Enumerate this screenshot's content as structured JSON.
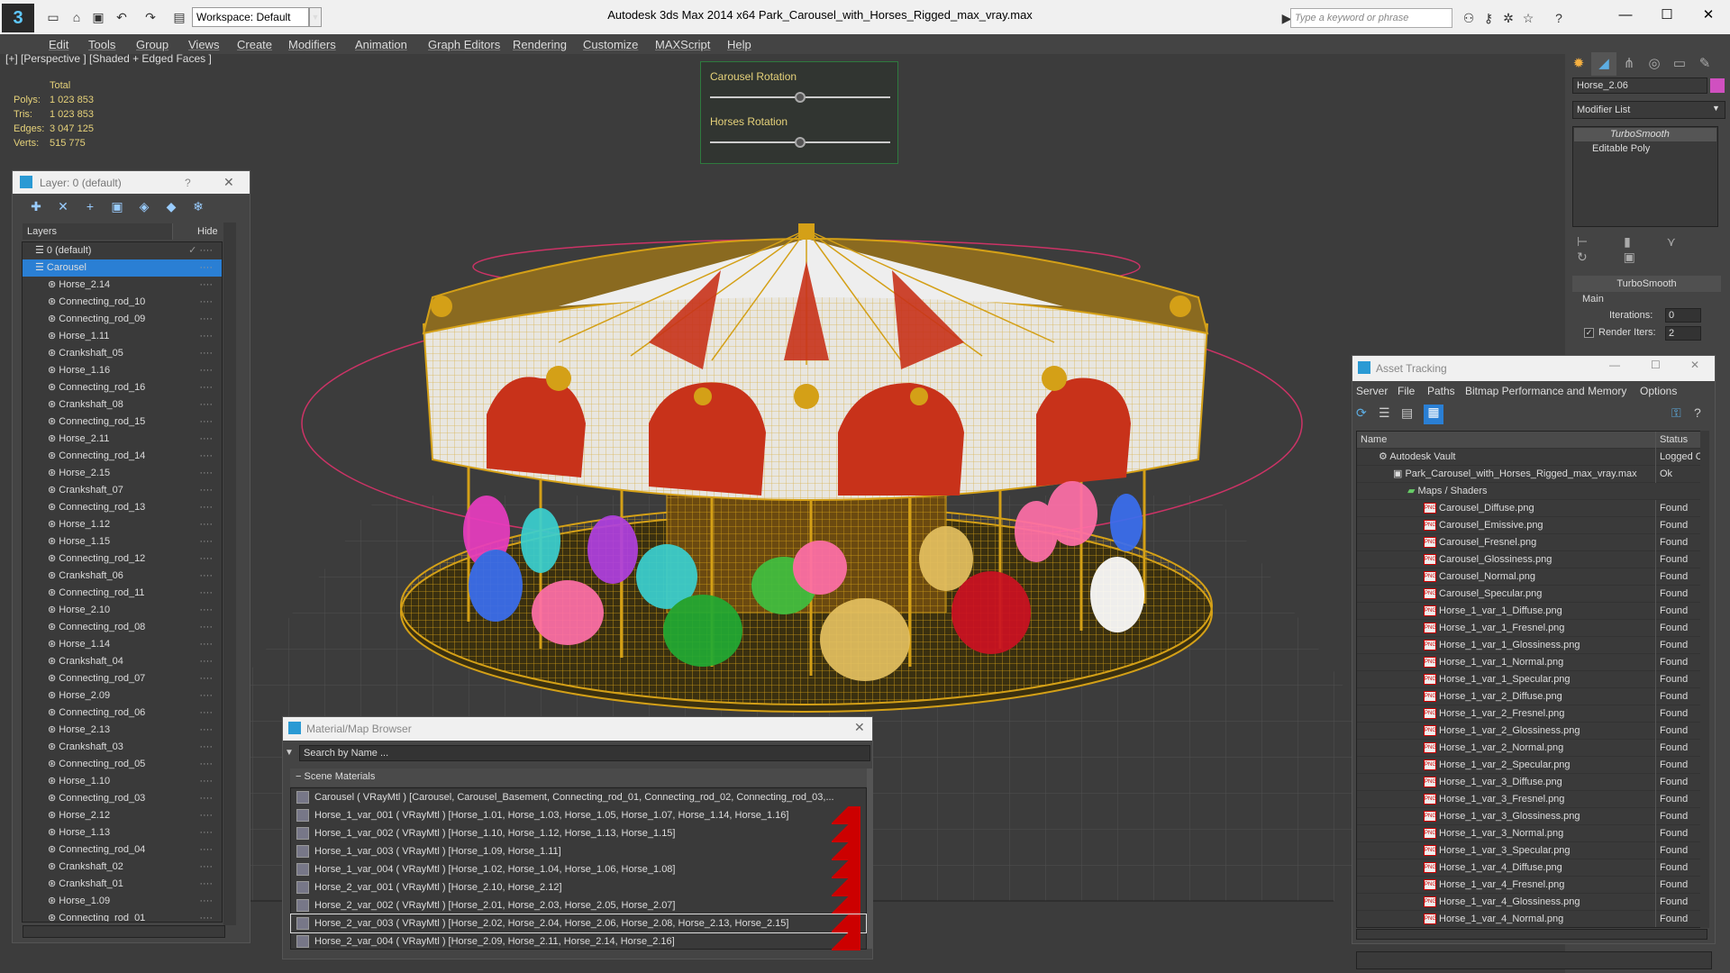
{
  "app": {
    "title": "Autodesk 3ds Max  2014 x64      Park_Carousel_with_Horses_Rigged_max_vray.max",
    "workspace": "Workspace: Default",
    "search_placeholder": "Type a keyword or phrase"
  },
  "menu": [
    "Edit",
    "Tools",
    "Group",
    "Views",
    "Create",
    "Modifiers",
    "Animation",
    "Graph Editors",
    "Rendering",
    "Customize",
    "MAXScript",
    "Help"
  ],
  "viewport": {
    "label": "[+] [Perspective ] [Shaded + Edged Faces ]",
    "stats_header": "Total",
    "stats": [
      {
        "label": "Polys:",
        "value": "1 023 853"
      },
      {
        "label": "Tris:",
        "value": "1 023 853"
      },
      {
        "label": "Edges:",
        "value": "3 047 125"
      },
      {
        "label": "Verts:",
        "value": "515 775"
      }
    ]
  },
  "sliders": [
    {
      "label": "Carousel Rotation",
      "value": 0.5
    },
    {
      "label": "Horses Rotation",
      "value": 0.5
    }
  ],
  "layer_panel": {
    "title": "Layer: 0 (default)",
    "help": "?",
    "col_layers": "Layers",
    "col_hide": "Hide",
    "items": [
      "0 (default)",
      "Carousel",
      "Horse_2.14",
      "Connecting_rod_10",
      "Connecting_rod_09",
      "Horse_1.11",
      "Crankshaft_05",
      "Horse_1.16",
      "Connecting_rod_16",
      "Crankshaft_08",
      "Connecting_rod_15",
      "Horse_2.11",
      "Connecting_rod_14",
      "Horse_2.15",
      "Crankshaft_07",
      "Connecting_rod_13",
      "Horse_1.12",
      "Horse_1.15",
      "Connecting_rod_12",
      "Crankshaft_06",
      "Connecting_rod_11",
      "Horse_2.10",
      "Connecting_rod_08",
      "Horse_1.14",
      "Crankshaft_04",
      "Connecting_rod_07",
      "Horse_2.09",
      "Connecting_rod_06",
      "Horse_2.13",
      "Crankshaft_03",
      "Connecting_rod_05",
      "Horse_1.10",
      "Connecting_rod_03",
      "Horse_2.12",
      "Horse_1.13",
      "Connecting_rod_04",
      "Crankshaft_02",
      "Crankshaft_01",
      "Horse_1.09",
      "Connecting_rod_01"
    ]
  },
  "command_panel": {
    "object_name": "Horse_2.06",
    "modifier_list": "Modifier List",
    "stack": [
      "TurboSmooth",
      "Editable Poly"
    ],
    "rollout_title": "TurboSmooth",
    "group_main": "Main",
    "iterations_label": "Iterations:",
    "iterations_value": "0",
    "render_iters_label": "Render Iters:",
    "render_iters_value": "2"
  },
  "asset_tracking": {
    "title": "Asset Tracking",
    "menu": [
      "Server",
      "File",
      "Paths",
      "Bitmap Performance and Memory",
      "Options"
    ],
    "col_name": "Name",
    "col_status": "Status",
    "vault": {
      "name": "Autodesk Vault",
      "status": "Logged O"
    },
    "file": {
      "name": "Park_Carousel_with_Horses_Rigged_max_vray.max",
      "status": "Ok"
    },
    "maps_group": "Maps / Shaders",
    "maps": [
      "Carousel_Diffuse.png",
      "Carousel_Emissive.png",
      "Carousel_Fresnel.png",
      "Carousel_Glossiness.png",
      "Carousel_Normal.png",
      "Carousel_Specular.png",
      "Horse_1_var_1_Diffuse.png",
      "Horse_1_var_1_Fresnel.png",
      "Horse_1_var_1_Glossiness.png",
      "Horse_1_var_1_Normal.png",
      "Horse_1_var_1_Specular.png",
      "Horse_1_var_2_Diffuse.png",
      "Horse_1_var_2_Fresnel.png",
      "Horse_1_var_2_Glossiness.png",
      "Horse_1_var_2_Normal.png",
      "Horse_1_var_2_Specular.png",
      "Horse_1_var_3_Diffuse.png",
      "Horse_1_var_3_Fresnel.png",
      "Horse_1_var_3_Glossiness.png",
      "Horse_1_var_3_Normal.png",
      "Horse_1_var_3_Specular.png",
      "Horse_1_var_4_Diffuse.png",
      "Horse_1_var_4_Fresnel.png",
      "Horse_1_var_4_Glossiness.png",
      "Horse_1_var_4_Normal.png"
    ],
    "found": "Found"
  },
  "material_browser": {
    "title": "Material/Map Browser",
    "search_placeholder": "Search by Name ...",
    "group": "Scene Materials",
    "items": [
      "Carousel  ( VRayMtl ) [Carousel, Carousel_Basement, Connecting_rod_01, Connecting_rod_02, Connecting_rod_03,...",
      "Horse_1_var_001  ( VRayMtl ) [Horse_1.01, Horse_1.03, Horse_1.05, Horse_1.07, Horse_1.14, Horse_1.16]",
      "Horse_1_var_002  ( VRayMtl ) [Horse_1.10, Horse_1.12, Horse_1.13, Horse_1.15]",
      "Horse_1_var_003  ( VRayMtl ) [Horse_1.09, Horse_1.11]",
      "Horse_1_var_004  ( VRayMtl ) [Horse_1.02, Horse_1.04, Horse_1.06, Horse_1.08]",
      "Horse_2_var_001  ( VRayMtl ) [Horse_2.10, Horse_2.12]",
      "Horse_2_var_002  ( VRayMtl ) [Horse_2.01, Horse_2.03, Horse_2.05, Horse_2.07]",
      "Horse_2_var_003  ( VRayMtl ) [Horse_2.02, Horse_2.04, Horse_2.06, Horse_2.08, Horse_2.13, Horse_2.15]",
      "Horse_2_var_004  ( VRayMtl ) [Horse_2.09, Horse_2.11, Horse_2.14, Horse_2.16]"
    ]
  },
  "colors": {
    "accent": "#2a7fd4",
    "wire": "#d4a017",
    "horse_colors": [
      "#e83cc0",
      "#3a6ef0",
      "#ff6fa8",
      "#3ad0d0",
      "#22aa33",
      "#e4c060",
      "#cc1122",
      "#ffffff",
      "#b040e0",
      "#40c040"
    ]
  }
}
